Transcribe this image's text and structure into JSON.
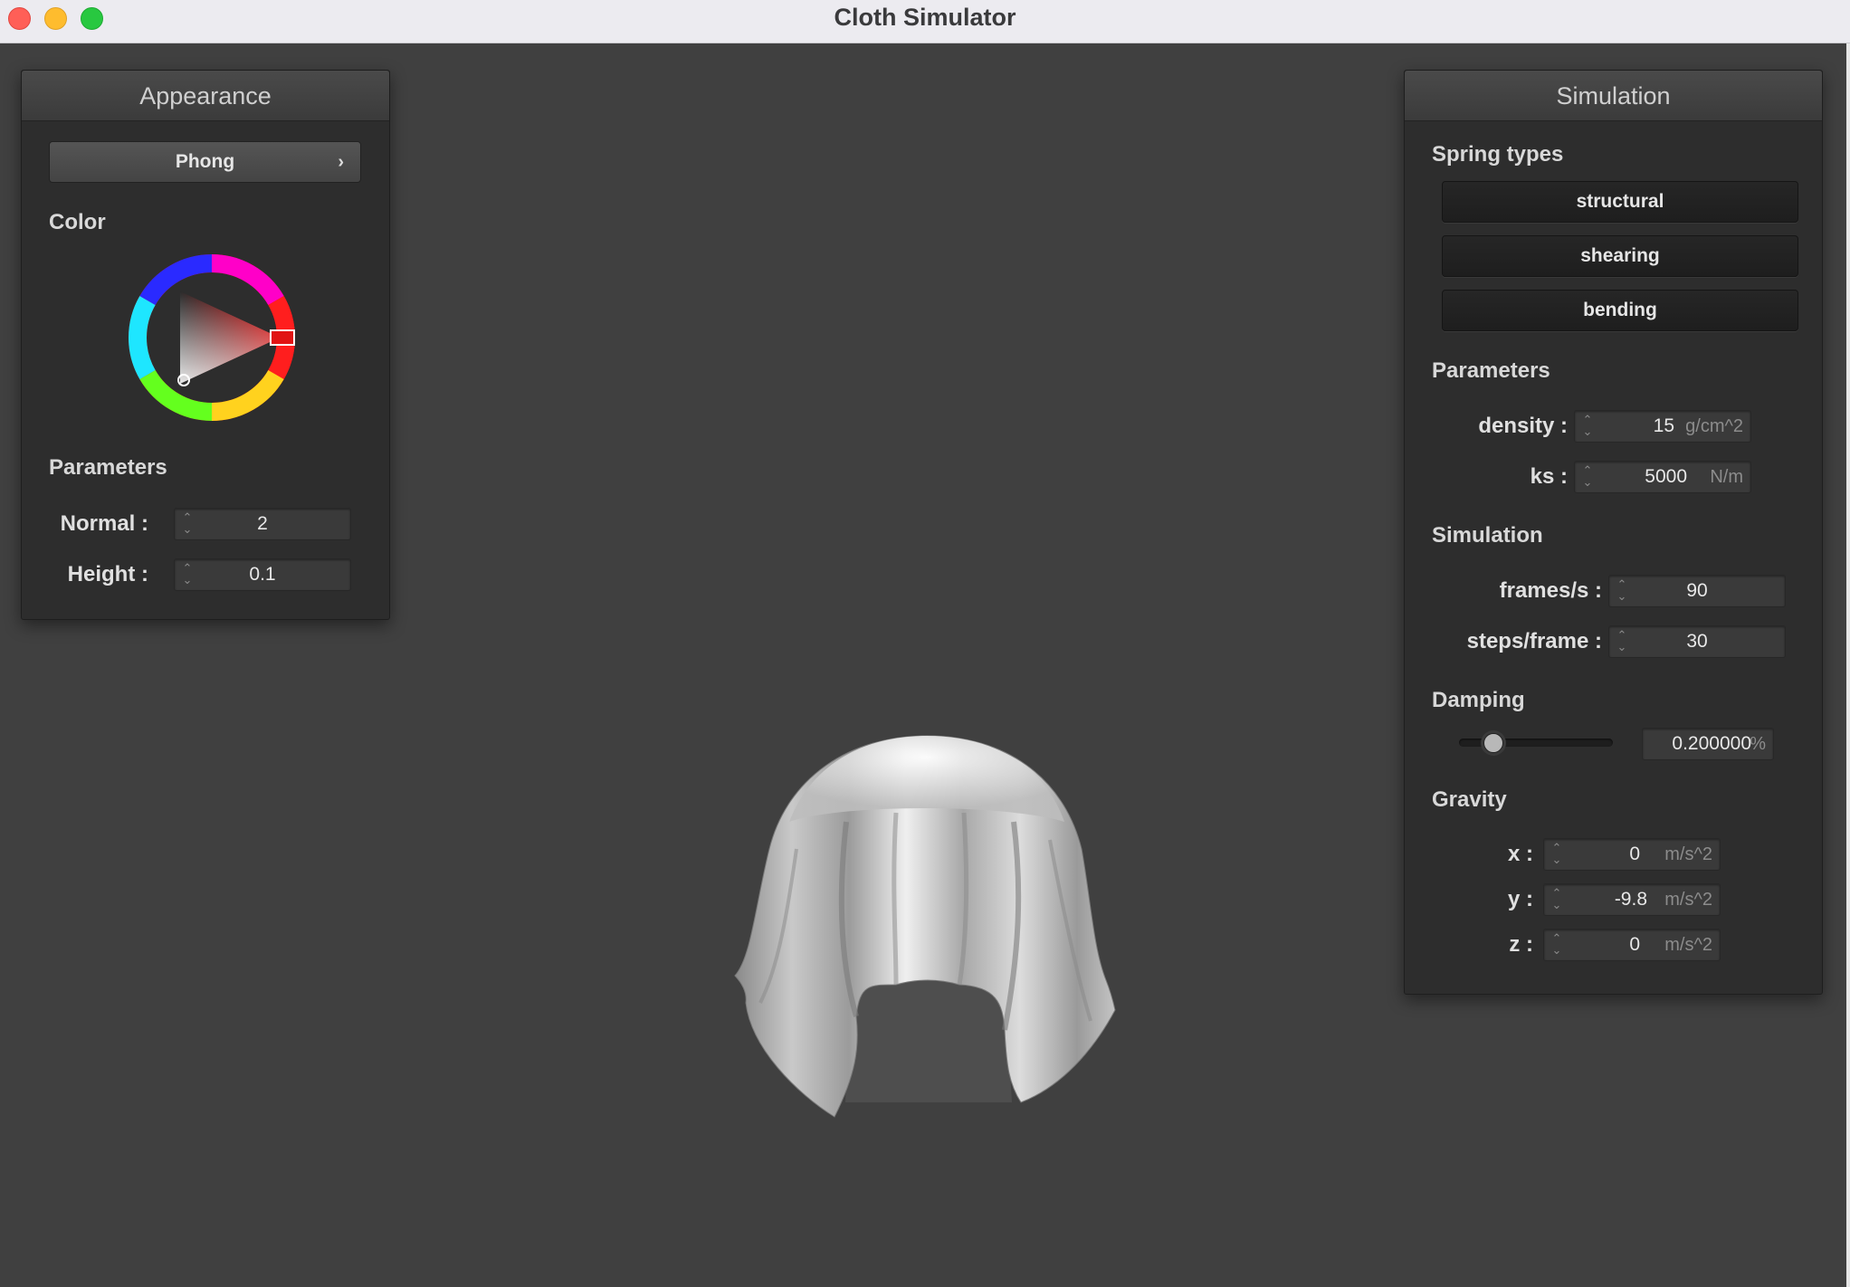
{
  "window": {
    "title": "Cloth Simulator"
  },
  "appearance": {
    "header": "Appearance",
    "shader_label": "Phong",
    "color_label": "Color",
    "color_value": "#e11414",
    "params_label": "Parameters",
    "fields": [
      {
        "label": "Normal :",
        "value": "2"
      },
      {
        "label": "Height :",
        "value": "0.1"
      }
    ]
  },
  "simulation": {
    "header": "Simulation",
    "spring_label": "Spring types",
    "springs": [
      "structural",
      "shearing",
      "bending"
    ],
    "params_label": "Parameters",
    "params": [
      {
        "label": "density :",
        "value": "15",
        "unit": "g/cm^2"
      },
      {
        "label": "ks :",
        "value": "5000",
        "unit": "N/m"
      }
    ],
    "sim_label": "Simulation",
    "sim_fields": [
      {
        "label": "frames/s :",
        "value": "90"
      },
      {
        "label": "steps/frame :",
        "value": "30"
      }
    ],
    "damping_label": "Damping",
    "damping_value": "0.200000",
    "damping_unit": "%",
    "damping_fraction": 0.2,
    "gravity_label": "Gravity",
    "gravity": [
      {
        "label": "x :",
        "value": "0",
        "unit": "m/s^2"
      },
      {
        "label": "y :",
        "value": "-9.8",
        "unit": "m/s^2"
      },
      {
        "label": "z :",
        "value": "0",
        "unit": "m/s^2"
      }
    ]
  }
}
